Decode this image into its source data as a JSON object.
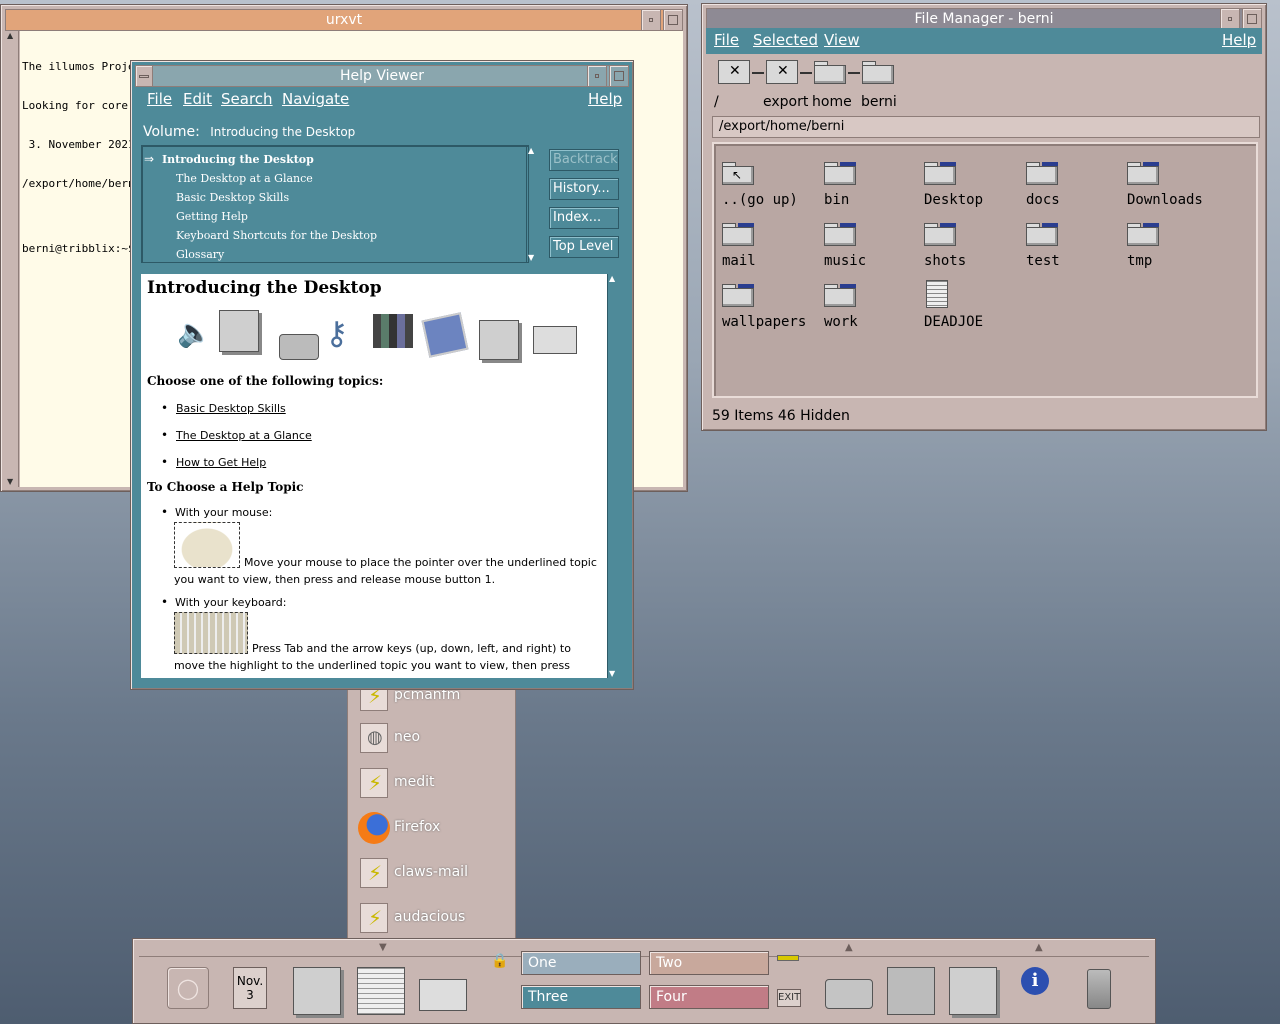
{
  "terminal": {
    "title": "urxvt",
    "lines": [
      "The illumos Project     tribblix-m25.1  October 2021",
      "Looking for core files in /export/home/berni .....",
      " 3. November 2021",
      "/export/home/berni",
      "",
      "berni@tribblix:~$"
    ]
  },
  "file_manager": {
    "title": "File Manager - berni",
    "menu": {
      "file": "File",
      "selected": "Selected",
      "view": "View",
      "help": "Help"
    },
    "path_parts": [
      "/",
      "export",
      "home",
      "berni"
    ],
    "path": "/export/home/berni",
    "items": [
      "..(go up)",
      "bin",
      "Desktop",
      "docs",
      "Downloads",
      "mail",
      "music",
      "shots",
      "test",
      "tmp",
      "wallpapers",
      "work",
      "DEADJOE"
    ],
    "status": "59 Items 46 Hidden"
  },
  "help_viewer": {
    "title": "Help Viewer",
    "menu": {
      "file": "File",
      "edit": "Edit",
      "search": "Search",
      "navigate": "Navigate",
      "help": "Help"
    },
    "volume_label": "Volume:",
    "volume_value": "Introducing the Desktop",
    "topics": [
      "Introducing the Desktop",
      "The Desktop at a Glance",
      "Basic Desktop Skills",
      "Getting Help",
      "Keyboard Shortcuts for the Desktop",
      "Glossary"
    ],
    "buttons": {
      "backtrack": "Backtrack",
      "history": "History...",
      "index": "Index...",
      "top_level": "Top Level"
    },
    "content": {
      "heading": "Introducing the Desktop",
      "choose": "Choose one of the following topics:",
      "links": [
        "Basic Desktop Skills",
        "The Desktop at a Glance",
        "How to Get Help"
      ],
      "subheading": "To Choose a Help Topic",
      "mouse_label": "With your mouse:",
      "mouse_text": "Move your mouse to place the pointer over the underlined topic you want to view, then press and release mouse button 1.",
      "keyboard_label": "With your keyboard:",
      "keyboard_text": "Press Tab and the arrow keys (up, down, left, and right) to move the highlight to the underlined topic you want to view, then press"
    }
  },
  "subpanel": {
    "items": [
      "pcmanfm",
      "neo",
      "medit",
      "Firefox",
      "claws-mail",
      "audacious"
    ]
  },
  "front_panel": {
    "date_month": "Nov.",
    "date_day": "3",
    "workspaces": [
      "One",
      "Two",
      "Three",
      "Four"
    ],
    "exit": "EXIT",
    "colors": {
      "one": "#9aaebc",
      "two": "#c8a89c",
      "three": "#4e8a99",
      "four": "#c17c86"
    }
  }
}
